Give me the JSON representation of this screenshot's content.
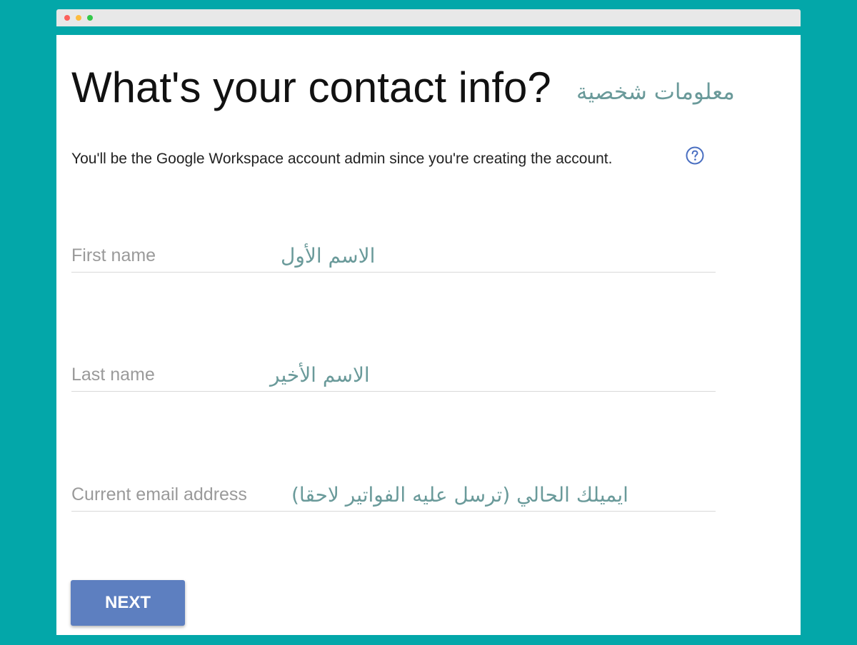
{
  "page": {
    "heading": "What's your contact info?",
    "heading_ar": "معلومات شخصية",
    "subtitle": "You'll be the Google Workspace account admin since you're creating the account.",
    "help_icon": "help-circle-icon"
  },
  "fields": [
    {
      "label": "First name",
      "annotation_ar": "الاسم الأول"
    },
    {
      "label": "Last name",
      "annotation_ar": "الاسم الأخير"
    },
    {
      "label": "Current email address",
      "annotation_ar": "ايميلك الحالي (ترسل عليه الفواتير لاحقا)"
    }
  ],
  "actions": {
    "next_label": "NEXT"
  },
  "colors": {
    "background": "#03a7a9",
    "button": "#5d7fc0",
    "annotation": "#6a9a9a"
  }
}
